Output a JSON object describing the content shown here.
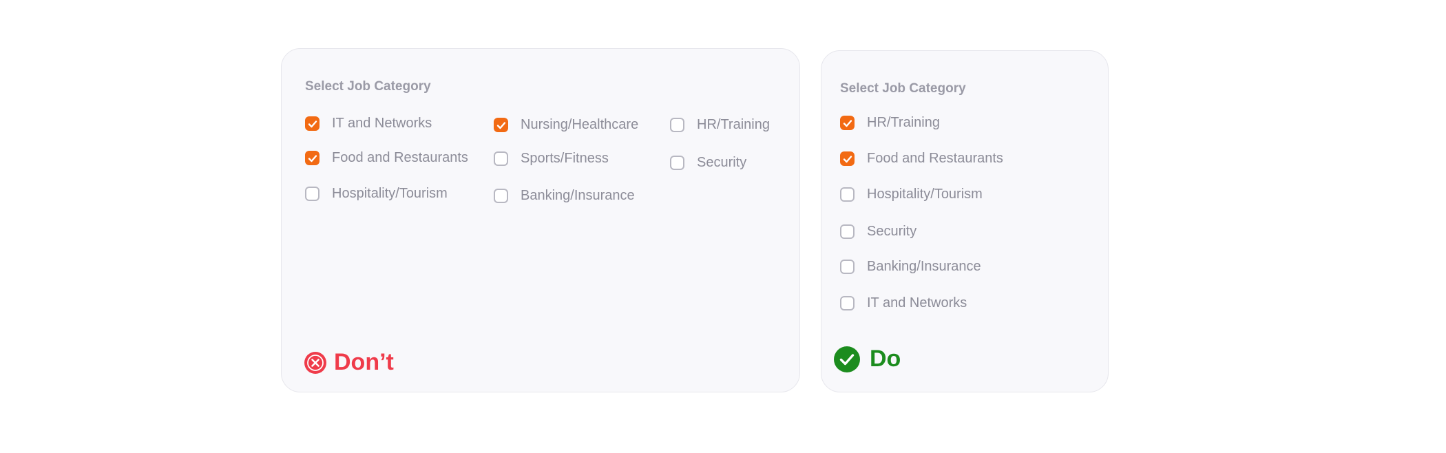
{
  "colors": {
    "checkbox_checked": "#f26a13",
    "dont_red": "#ef3b4a",
    "do_green": "#1c8c1e"
  },
  "dont_card": {
    "title": "Select Job Category",
    "options": [
      {
        "label": "IT and Networks",
        "checked": true
      },
      {
        "label": "Food and Restaurants",
        "checked": true
      },
      {
        "label": "Hospitality/Tourism",
        "checked": false
      },
      {
        "label": "Nursing/Healthcare",
        "checked": true
      },
      {
        "label": "Sports/Fitness",
        "checked": false
      },
      {
        "label": "Banking/Insurance",
        "checked": false
      },
      {
        "label": "HR/Training",
        "checked": false
      },
      {
        "label": "Security",
        "checked": false
      }
    ],
    "verdict": "Don’t",
    "verdict_icon": "x-circle-icon"
  },
  "do_card": {
    "title": "Select Job Category",
    "options": [
      {
        "label": "HR/Training",
        "checked": true
      },
      {
        "label": "Food and Restaurants",
        "checked": true
      },
      {
        "label": "Hospitality/Tourism",
        "checked": false
      },
      {
        "label": "Security",
        "checked": false
      },
      {
        "label": "Banking/Insurance",
        "checked": false
      },
      {
        "label": "IT and Networks",
        "checked": false
      }
    ],
    "verdict": "Do",
    "verdict_icon": "check-circle-icon"
  }
}
